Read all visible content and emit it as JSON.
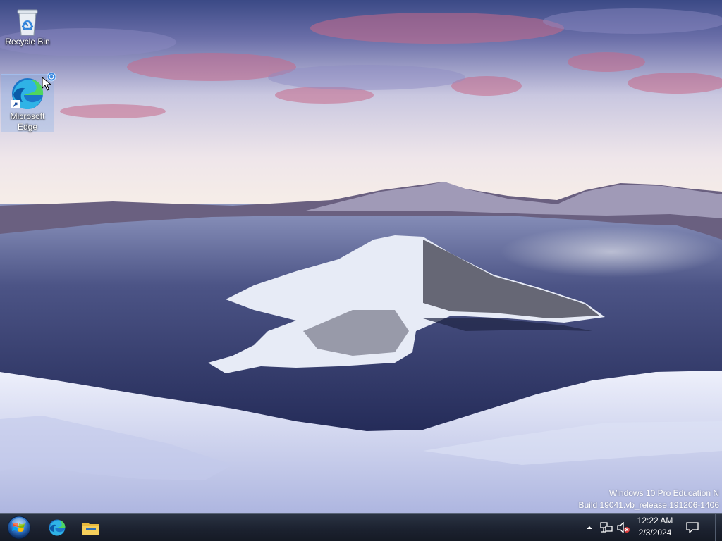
{
  "desktop": {
    "icons": [
      {
        "label": "Recycle Bin",
        "icon": "recycle-bin-icon"
      },
      {
        "label": "Microsoft Edge",
        "icon": "edge-icon",
        "selected": true
      }
    ],
    "watermark": {
      "edition": "Windows 10 Pro Education N",
      "build": "Build 19041.vb_release.191206-1406"
    }
  },
  "taskbar": {
    "start_icon": "windows-start-orb-icon",
    "pinned": [
      {
        "icon": "edge-icon"
      },
      {
        "icon": "file-explorer-icon"
      }
    ],
    "tray": {
      "icons": [
        "show-hidden-icons-chevron-icon",
        "network-icon",
        "volume-muted-icon"
      ],
      "time": "12:22 AM",
      "date": "2/3/2024",
      "notification_icon": "action-center-icon"
    }
  },
  "colors": {
    "taskbar": "#1c2230",
    "selection": "#78aae6"
  }
}
